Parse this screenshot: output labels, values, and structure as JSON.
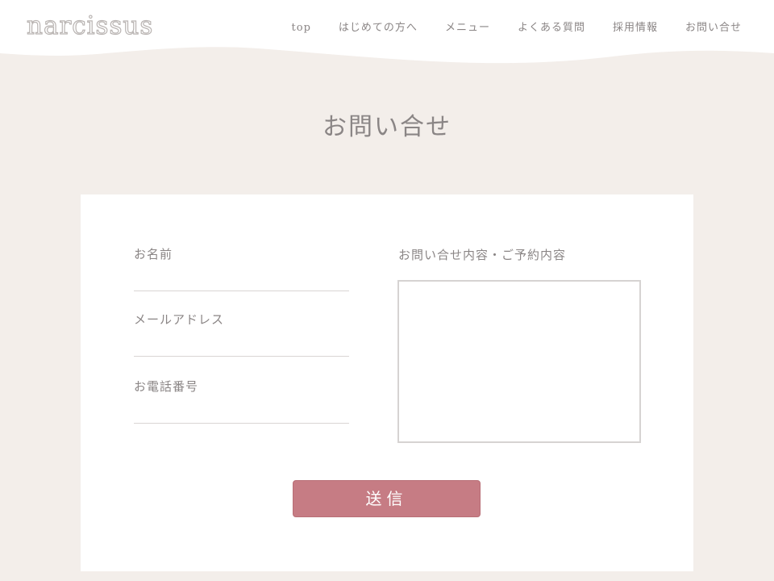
{
  "header": {
    "logo": "narcissus",
    "nav": [
      {
        "label": "top"
      },
      {
        "label": "はじめての方へ"
      },
      {
        "label": "メニュー"
      },
      {
        "label": "よくある質問"
      },
      {
        "label": "採用情報"
      },
      {
        "label": "お問い合せ"
      }
    ]
  },
  "page": {
    "title": "お問い合せ"
  },
  "form": {
    "name_label": "お名前",
    "name_value": "",
    "email_label": "メールアドレス",
    "email_value": "",
    "phone_label": "お電話番号",
    "phone_value": "",
    "message_label": "お問い合せ内容・ご予約内容",
    "message_value": "",
    "submit_label": "送信"
  },
  "colors": {
    "background": "#f3eeea",
    "card": "#ffffff",
    "submit_button": "#c67c84",
    "text": "#8a8585"
  }
}
